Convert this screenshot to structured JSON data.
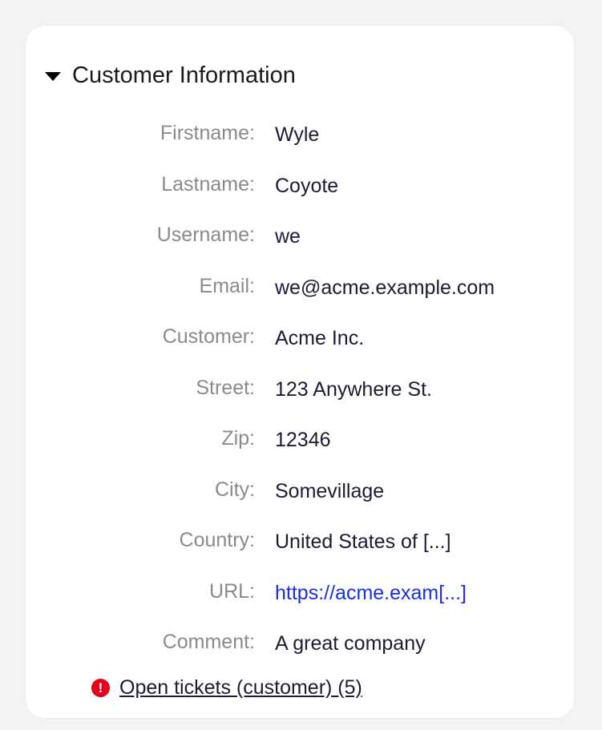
{
  "panel": {
    "title": "Customer Information",
    "collapse_icon": "caret-down-icon"
  },
  "fields": [
    {
      "label": "Firstname:",
      "value": "Wyle"
    },
    {
      "label": "Lastname:",
      "value": "Coyote"
    },
    {
      "label": "Username:",
      "value": "we"
    },
    {
      "label": "Email:",
      "value": "we@acme.example.com"
    },
    {
      "label": "Customer:",
      "value": "Acme Inc."
    },
    {
      "label": "Street:",
      "value": "123 Anywhere St."
    },
    {
      "label": "Zip:",
      "value": "12346"
    },
    {
      "label": "City:",
      "value": "Somevillage"
    },
    {
      "label": "Country:",
      "value": "United States of [...]"
    },
    {
      "label": "URL:",
      "value": "https://acme.exam[...]"
    },
    {
      "label": "Comment:",
      "value": "A great company"
    }
  ],
  "open_tickets": {
    "icon": "warning-circle-icon",
    "icon_glyph": "!",
    "label": "Open tickets (customer) (5)"
  },
  "colors": {
    "label": "#8a8a8a",
    "value": "#1c1c33",
    "link": "#1a2fe0",
    "warning": "#e5001c"
  }
}
